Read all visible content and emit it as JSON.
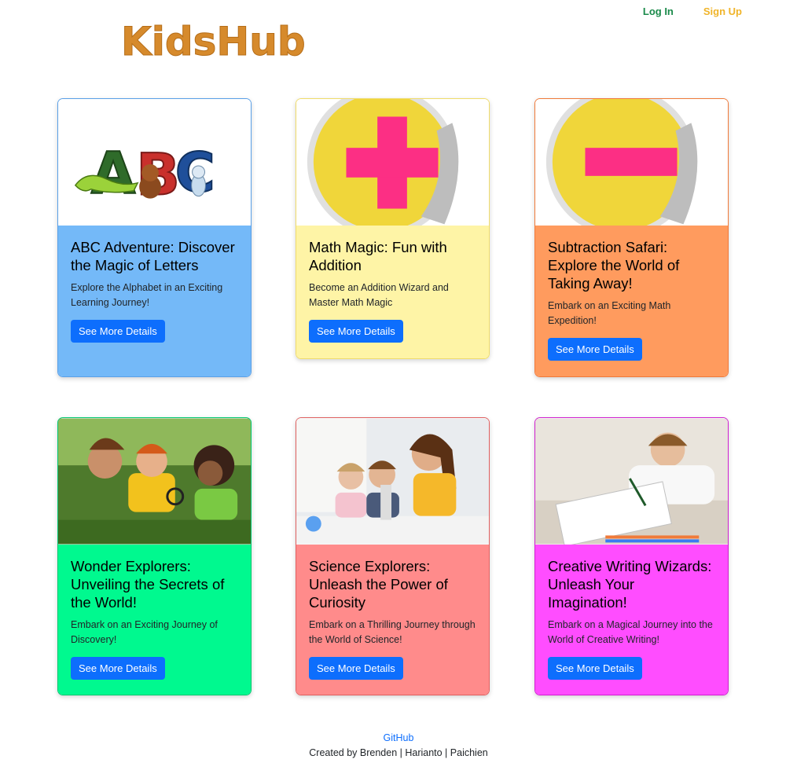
{
  "logo": {
    "text": "KidsHub"
  },
  "nav": {
    "login": "Log In",
    "signup": "Sign Up"
  },
  "cards": [
    {
      "title": "ABC Adventure: Discover the Magic of Letters",
      "text": "Explore the Alphabet in an Exciting Learning Journey!",
      "button": "See More Details",
      "color": "#74b9f8",
      "border": "#5aa0e8"
    },
    {
      "title": "Math Magic: Fun with Addition",
      "text": "Become an Addition Wizard and Master Math Magic",
      "button": "See More Details",
      "color": "#fef4a6",
      "border": "#f0dc6a"
    },
    {
      "title": "Subtraction Safari: Explore the World of Taking Away!",
      "text": "Embark on an Exciting Math Expedition!",
      "button": "See More Details",
      "color": "#ff9b5e",
      "border": "#f07a3a"
    },
    {
      "title": "Wonder Explorers: Unveiling the Secrets of the World!",
      "text": "Embark on an Exciting Journey of Discovery!",
      "button": "See More Details",
      "color": "#00f98f",
      "border": "#00c870"
    },
    {
      "title": "Science Explorers: Unleash the Power of Curiosity",
      "text": "Embark on a Thrilling Journey through the World of Science!",
      "button": "See More Details",
      "color": "#ff8b8b",
      "border": "#e06060"
    },
    {
      "title": "Creative Writing Wizards: Unleash Your Imagination!",
      "text": "Embark on a Magical Journey into the World of Creative Writing!",
      "button": "See More Details",
      "color": "#ff4dff",
      "border": "#d020d0"
    }
  ],
  "footer": {
    "link": "GitHub",
    "credits": "Created by Brenden | Harianto | Paichien"
  }
}
